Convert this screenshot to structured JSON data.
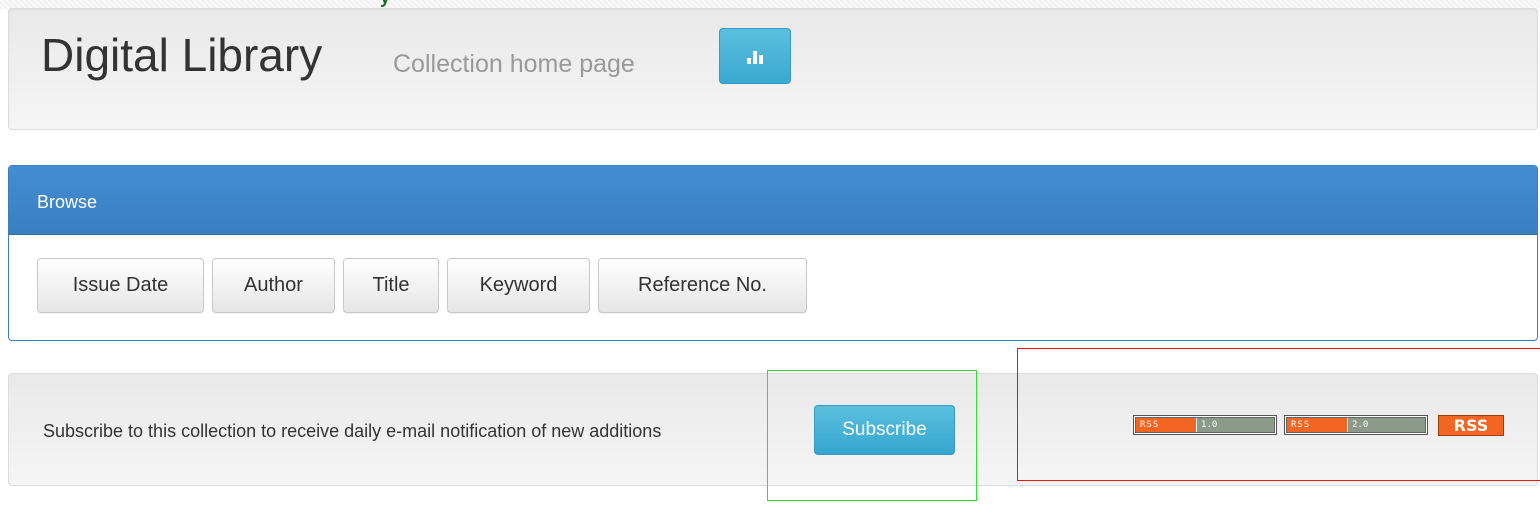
{
  "header": {
    "title": "Digital Library",
    "subtitle": "Collection home page",
    "stats_button_icon": "bar-chart-icon"
  },
  "browse": {
    "title": "Browse",
    "buttons": [
      {
        "label": "Issue Date"
      },
      {
        "label": "Author"
      },
      {
        "label": "Title"
      },
      {
        "label": "Keyword"
      },
      {
        "label": "Reference No."
      }
    ]
  },
  "subscribe": {
    "text": "Subscribe to this collection to receive daily e-mail notification of new additions",
    "button_label": "Subscribe"
  },
  "feeds": [
    {
      "left": "RSS",
      "right": "1.0"
    },
    {
      "left": "RSS",
      "right": "2.0"
    },
    {
      "label": "RSS"
    }
  ],
  "colors": {
    "panel_primary": "#3a7fc0",
    "info_button": "#5bc0de",
    "rss_orange": "#f26522",
    "highlight_green": "#33dd33",
    "highlight_red": "#ee1111"
  }
}
